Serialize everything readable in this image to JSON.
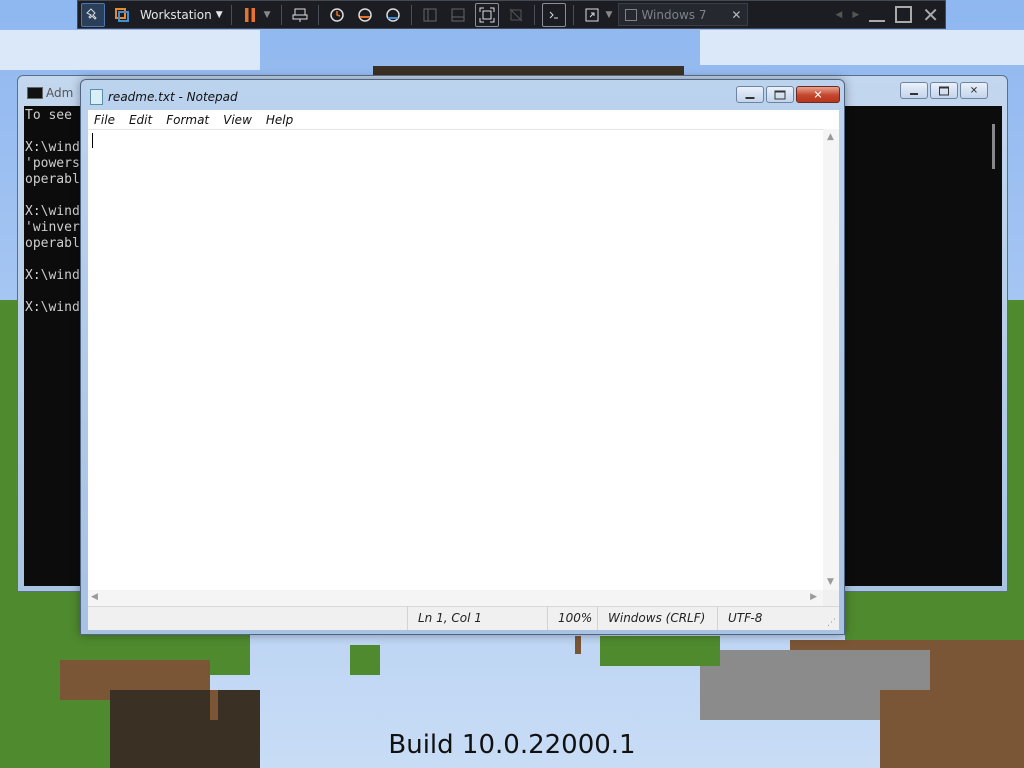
{
  "toolbar": {
    "workstation_label": "Workstation",
    "vm_tab_label": "Windows 7",
    "vm_tab_close": "✕"
  },
  "cmd": {
    "title": "Adm",
    "lines": [
      "To see",
      "",
      "X:\\wind",
      "'powers",
      "operabl",
      "",
      "X:\\wind",
      "'winver",
      "operabl",
      "",
      "X:\\wind",
      "",
      "X:\\wind"
    ]
  },
  "notepad": {
    "title": "readme.txt - Notepad",
    "menu": [
      "File",
      "Edit",
      "Format",
      "View",
      "Help"
    ],
    "status": {
      "position": "Ln 1, Col 1",
      "zoom": "100%",
      "line_ending": "Windows (CRLF)",
      "encoding": "UTF-8"
    }
  },
  "desktop": {
    "build_text": "Build 10.0.22000.1"
  },
  "colors": {
    "accent_pause": "#e8742c",
    "accent_blue": "#3e8fd8",
    "titlebar": "#bcd3ee",
    "console_bg": "#0c0c0c"
  }
}
